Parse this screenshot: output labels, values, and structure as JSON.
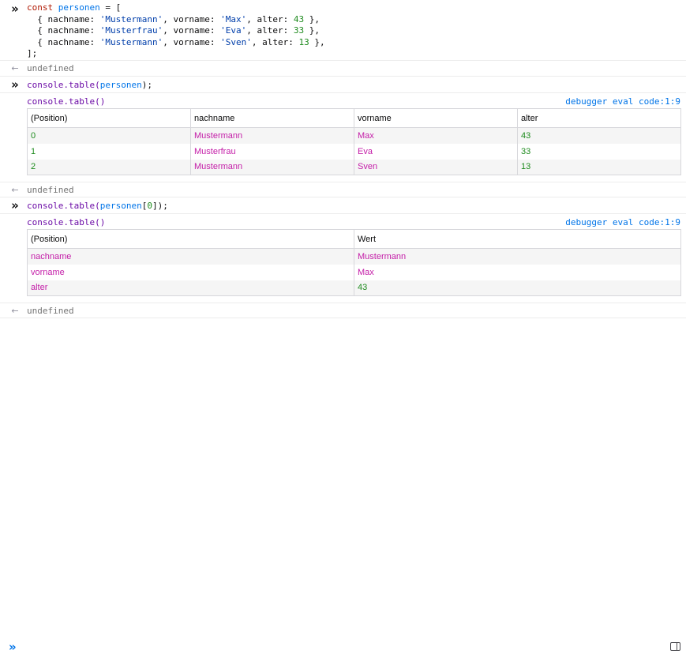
{
  "icons": {
    "command": "double-chevron-right-icon",
    "result": "arrow-left-icon",
    "input": "double-chevron-right-icon",
    "sidebar": "sidebar-toggle-icon"
  },
  "entry1": {
    "line1": {
      "kw": "const",
      "var": "personen",
      "rest": " = ["
    },
    "rows": [
      {
        "nachname": "'Mustermann'",
        "vorname": "'Max'",
        "alter": "43"
      },
      {
        "nachname": "'Musterfrau'",
        "vorname": "'Eva'",
        "alter": "33"
      },
      {
        "nachname": "'Mustermann'",
        "vorname": "'Sven'",
        "alter": "13"
      }
    ],
    "k_nachname": "nachname",
    "k_vorname": "vorname",
    "k_alter": "alter",
    "close": "];",
    "result": "undefined"
  },
  "entry2": {
    "cmd_fn": "console.table(",
    "cmd_arg": "personen",
    "cmd_end": ");",
    "table_title": "console.table()",
    "source": "debugger eval code:1:9",
    "headers": [
      "(Position)",
      "nachname",
      "vorname",
      "alter"
    ],
    "rows": [
      [
        "0",
        "Mustermann",
        "Max",
        "43"
      ],
      [
        "1",
        "Musterfrau",
        "Eva",
        "33"
      ],
      [
        "2",
        "Mustermann",
        "Sven",
        "13"
      ]
    ],
    "result": "undefined"
  },
  "entry3": {
    "cmd_fn": "console.table(",
    "cmd_arg": "personen",
    "cmd_idx": "0",
    "cmd_end": ");",
    "table_title": "console.table()",
    "source": "debugger eval code:1:9",
    "headers": [
      "(Position)",
      "Wert"
    ],
    "rows": [
      [
        "nachname",
        "Mustermann"
      ],
      [
        "vorname",
        "Max"
      ],
      [
        "alter",
        "43"
      ]
    ],
    "result": "undefined"
  },
  "colors": {
    "keyword": "#b11a04",
    "variable": "#0074e8",
    "string": "#003eaa",
    "number": "#1e8b1e",
    "function": "#6b0ba6",
    "cell_string": "#c41ea8"
  }
}
